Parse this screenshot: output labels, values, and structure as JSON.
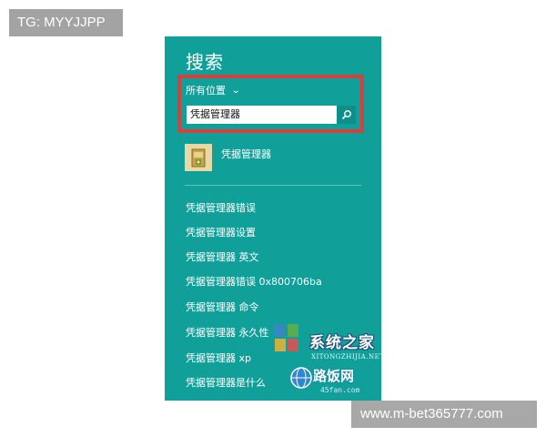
{
  "badges": {
    "top_left": "TG: MYYJJPP",
    "bottom_right": "www.m-bet365777.com"
  },
  "search_panel": {
    "title": "搜索",
    "scope_label": "所有位置",
    "search_value": "凭据管理器",
    "app_result": {
      "label": "凭据管理器",
      "icon": "credential-manager-icon"
    },
    "suggestions": [
      "凭据管理器错误",
      "凭据管理器设置",
      "凭据管理器 英文",
      "凭据管理器错误 0x800706ba",
      "凭据管理器 命令",
      "凭据管理器 永久性",
      "凭据管理器 xp",
      "凭据管理器是什么"
    ]
  },
  "watermark": {
    "name": "系统之家",
    "pinyin": "XITONGZHIJIA.NET",
    "site": "路饭网",
    "domain": "45fan.com"
  },
  "colors": {
    "panel_bg": "#11a099",
    "highlight_border": "#d8403c",
    "search_button": "#0f8e8a"
  }
}
